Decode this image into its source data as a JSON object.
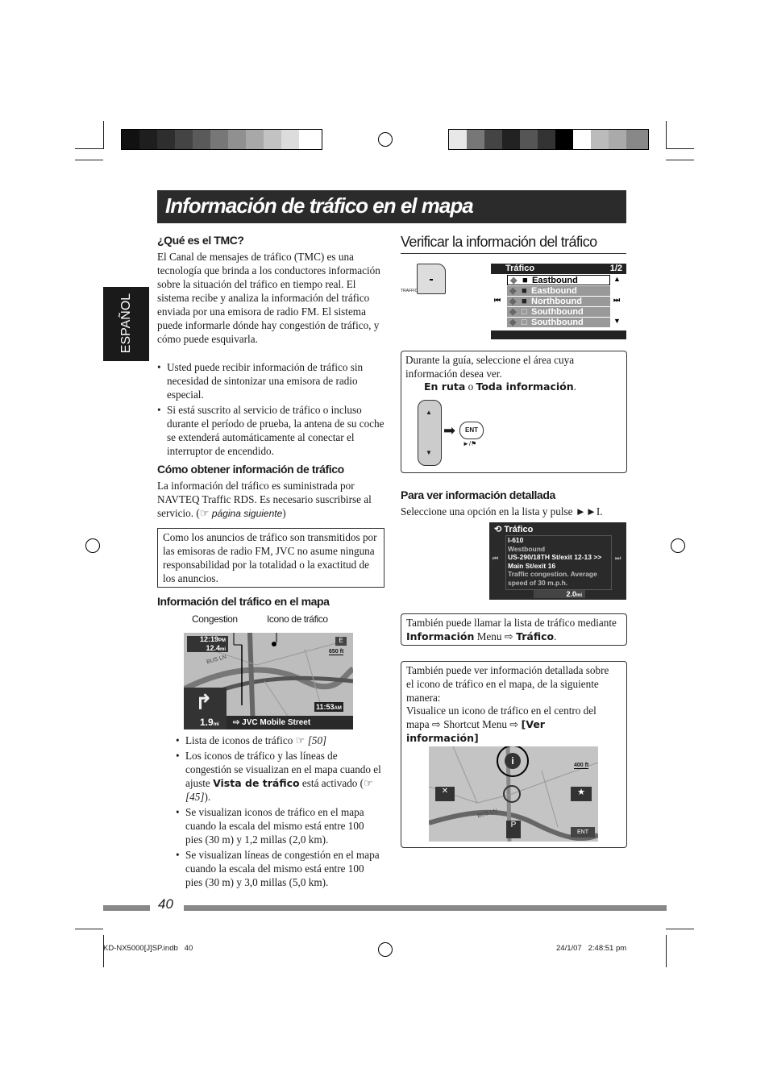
{
  "title": "Información de tráfico en el mapa",
  "side_tab": "ESPAÑOL",
  "left": {
    "tmc_heading": "¿Qué es el TMC?",
    "tmc_text": "El Canal de mensajes de tráfico (TMC) es una tecnología que brinda a los conductores información sobre la situación del tráfico en tiempo real. El sistema recibe y analiza la información del tráfico enviada por una emisora de radio FM. El sistema puede informarle dónde hay congestión de tráfico, y cómo puede esquivarla.",
    "tmc_bullets": [
      "Usted puede recibir información de tráfico sin necesidad de sintonizar una emisora de radio especial.",
      "Si está suscrito al servicio de tráfico o incluso durante el período de prueba, la antena de su coche se extenderá automáticamente al conectar el interruptor de encendido."
    ],
    "obtain_heading": "Cómo obtener información de tráfico",
    "obtain_text": "La información del tráfico es suministrada por NAVTEQ Traffic RDS. Es necesario suscribirse al servicio. (",
    "obtain_ref_icon": "hand-pointing-icon",
    "obtain_ref": "página siguiente",
    "obtain_close": ")",
    "disclaimer": "Como los anuncios de tráfico son transmitidos por las emisoras de radio FM, JVC no asume ninguna responsabilidad por la totalidad o la exactitud de los anuncios.",
    "map_heading": "Información del tráfico en el mapa",
    "map_label_congestion": "Congestion",
    "map_label_icon": "Icono de tráfico",
    "map_screen": {
      "time_eta": "12:19",
      "eta_unit": "PM",
      "eta_dist": "12.4",
      "dist_unit": "mi",
      "compass": "E",
      "scale": "650 ft",
      "street_label": "BUS LN",
      "clock": "11:53",
      "clock_unit": "AM",
      "turn_dist": "1.9",
      "turn_unit": "mi",
      "next_street": "JVC Mobile Street"
    },
    "map_bullets": [
      {
        "text": "Lista de iconos de tráfico ",
        "ref": "[50]"
      },
      {
        "text": "Los iconos de tráfico y las líneas de congestión se visualizan en el mapa cuando el ajuste ",
        "bold": "Vista de tráfico",
        "after": " está activado (",
        "ref": "[45]",
        "end": ")."
      },
      {
        "text": "Se visualizan iconos de tráfico en el mapa cuando la escala del mismo está entre 100 pies (30 m) y 1,2 millas (2,0 km)."
      },
      {
        "text": "Se visualizan líneas de congestión en el mapa cuando la escala del mismo está entre 100 pies (30 m) y 3,0 millas (5,0 km)."
      }
    ]
  },
  "right": {
    "heading": "Verificar la información del tráfico",
    "traffic_button_label": "TRAFFIC",
    "list_screen": {
      "title": "Tráfico",
      "page": "1/2",
      "rows": [
        "Eastbound",
        "Eastbound",
        "Northbound",
        "Southbound",
        "Southbound"
      ]
    },
    "step_text": "Durante la guía, seleccione el área cuya información desea ver.",
    "step_opt1": "En ruta",
    "step_or": " o ",
    "step_opt2": "Toda información",
    "step_dot": ".",
    "ent_label": "ENT",
    "ent_sub": "►/⚑",
    "detail_heading": "Para ver información detallada",
    "detail_text": "Seleccione una opción en la lista y pulse ►►I.",
    "detail_screen": {
      "title": "Tráfico",
      "lines": [
        "I-610",
        "Westbound",
        "US-290/18TH St/exit 12-13 >>",
        "Main St/exit 16",
        "Traffic congestion. Average",
        "speed of 30 m.p.h."
      ],
      "distance": "2.0",
      "unit": "mi"
    },
    "note1_a": "También puede llamar la lista de tráfico mediante ",
    "note1_b": "Información",
    "note1_c": " Menu ⇨ ",
    "note1_d": "Tráfico",
    "note1_e": ".",
    "note2_a": "También puede ver información detallada sobre el icono de tráfico en el mapa, de la siguiente manera:",
    "note2_b": "Visualice un icono de tráfico en el centro del mapa ⇨ Shortcut Menu ⇨ ",
    "note2_c": "[Ver información]",
    "map2": {
      "scale": "400 ft",
      "street_label": "BUS LN",
      "ent": "ENT"
    }
  },
  "page_number": "40",
  "footer": {
    "file": "KD-NX5000[J]SP.indb   40",
    "timestamp": "24/1/07   2:48:51 pm"
  }
}
